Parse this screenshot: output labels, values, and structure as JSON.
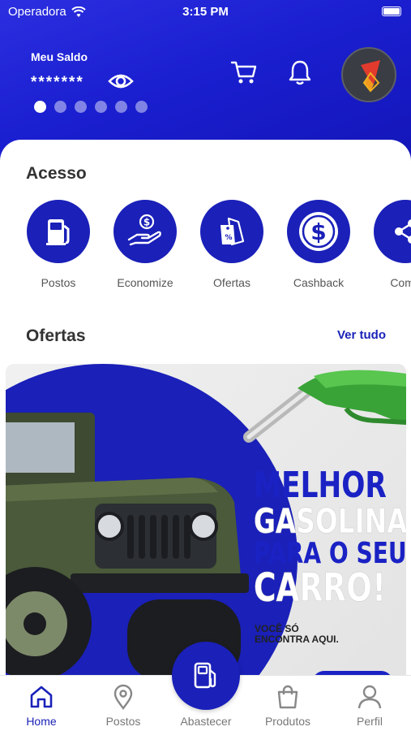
{
  "status_bar": {
    "carrier": "Operadora",
    "time": "3:15 PM"
  },
  "header": {
    "balance_label": "Meu Saldo",
    "balance_value": "*******",
    "carousel_dots": 6,
    "icons": [
      "eye-icon",
      "cart-icon",
      "bell-icon",
      "avatar"
    ]
  },
  "acesso": {
    "title": "Acesso",
    "items": [
      {
        "label": "Postos",
        "icon": "gas-pump-icon"
      },
      {
        "label": "Economize",
        "icon": "hand-coin-icon"
      },
      {
        "label": "Ofertas",
        "icon": "price-tag-icon"
      },
      {
        "label": "Cashback",
        "icon": "dollar-coin-icon"
      },
      {
        "label": "Comp",
        "icon": "share-icon"
      }
    ]
  },
  "ofertas": {
    "title": "Ofertas",
    "see_all": "Ver tudo",
    "banner": {
      "line1": "MELHOR",
      "line2": "GASOLINA",
      "line3": "PARA O SEU",
      "line4": "CARRO!",
      "subtitle": "VOCÊ SÓ ENCONTRA AQUI."
    }
  },
  "tabbar": {
    "tabs": [
      {
        "label": "Home",
        "icon": "home-icon",
        "active": true
      },
      {
        "label": "Postos",
        "icon": "location-pin-icon",
        "active": false
      },
      {
        "label": "Abastecer",
        "icon": "fuel-pump-icon",
        "active": false
      },
      {
        "label": "Produtos",
        "icon": "shopping-bag-icon",
        "active": false
      },
      {
        "label": "Perfil",
        "icon": "user-icon",
        "active": false
      }
    ]
  },
  "colors": {
    "primary": "#1a20b8",
    "header": "#1f24d2",
    "text": "#333333"
  }
}
